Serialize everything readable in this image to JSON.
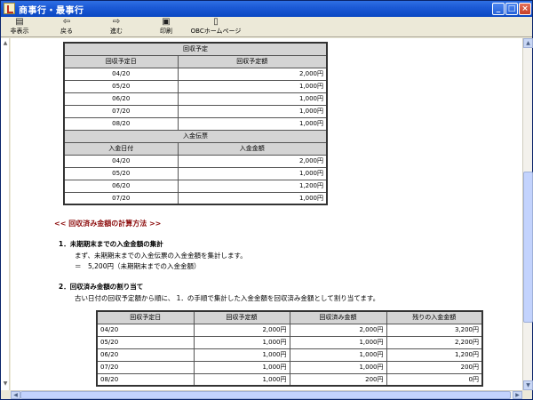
{
  "window": {
    "title": "商事行・最事行"
  },
  "toolbar": {
    "items": [
      {
        "label": "非表示"
      },
      {
        "label": "戻る"
      },
      {
        "label": "進む"
      },
      {
        "label": "印刷"
      },
      {
        "label": "OBCホームページ"
      }
    ]
  },
  "table1": {
    "section1_title": "回収予定",
    "col1": "回収予定日",
    "col2": "回収予定額",
    "rows1": [
      [
        "04/20",
        "2,000円"
      ],
      [
        "05/20",
        "1,000円"
      ],
      [
        "06/20",
        "1,000円"
      ],
      [
        "07/20",
        "1,000円"
      ],
      [
        "08/20",
        "1,000円"
      ]
    ],
    "section2_title": "入金伝票",
    "col3": "入金日付",
    "col4": "入金金額",
    "rows2": [
      [
        "04/20",
        "2,000円"
      ],
      [
        "05/20",
        "1,000円"
      ],
      [
        "06/20",
        "1,200円"
      ],
      [
        "07/20",
        "1,000円"
      ]
    ]
  },
  "method": {
    "heading": "<< 回収済み金額の計算方法 >>",
    "step1_title": "1．未期期末までの入金金額の集計",
    "step1_line1": "まず、未期期末までの入金伝票の入金金額を集計します。",
    "step1_line2": "＝　5,200円（未期期末までの入金金額）",
    "step2_title": "2．回収済み金額の割り当て",
    "step2_line1": "古い日付の回収予定額から順に、 1．の手順で集計した入金金額を回収済み金額として割り当てます。"
  },
  "table2": {
    "headers": [
      "回収予定日",
      "回収予定額",
      "回収済み金額",
      "残りの入金金額"
    ],
    "rows": [
      [
        "04/20",
        "2,000円",
        "2,000円",
        "3,200円"
      ],
      [
        "05/20",
        "1,000円",
        "1,000円",
        "2,200円"
      ],
      [
        "06/20",
        "1,000円",
        "1,000円",
        "1,200円"
      ],
      [
        "07/20",
        "1,000円",
        "1,000円",
        "200円"
      ],
      [
        "08/20",
        "1,000円",
        "200円",
        "0円"
      ]
    ]
  }
}
